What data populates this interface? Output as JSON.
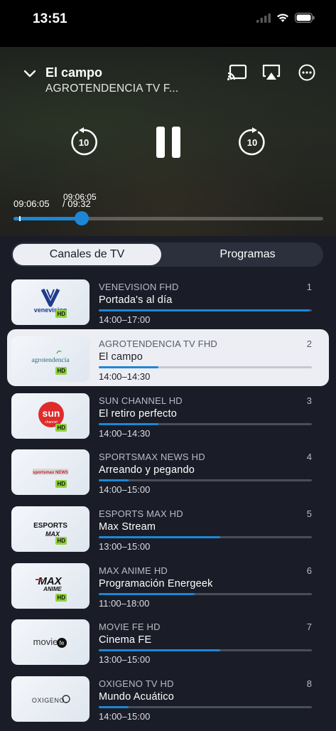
{
  "status": {
    "time": "13:51"
  },
  "player": {
    "title": "El campo",
    "subtitle": "AGROTENDENCIA TV F...",
    "skip_back_label": "10",
    "skip_fwd_label": "10",
    "time_current": "09:06:05",
    "time_hover": "09:06:05",
    "time_total": "/ 09:32",
    "progress_fraction": 0.22
  },
  "tabs": {
    "channels": "Canales de TV",
    "programs": "Programas"
  },
  "channels": [
    {
      "name": "VENEVISION FHD",
      "number": "1",
      "program": "Portada's al día",
      "times": "14:00–17:00",
      "progress": 0.99,
      "logo": "venevision",
      "hd": "HD"
    },
    {
      "name": "AGROTENDENCIA TV FHD",
      "number": "2",
      "program": "El campo",
      "times": "14:00–14:30",
      "progress": 0.28,
      "logo": "agrotendencia",
      "hd": "HD"
    },
    {
      "name": "SUN CHANNEL HD",
      "number": "3",
      "program": "El retiro perfecto",
      "times": "14:00–14:30",
      "progress": 0.28,
      "logo": "sun",
      "hd": "HD"
    },
    {
      "name": "SPORTSMAX NEWS HD",
      "number": "4",
      "program": "Arreando y pegando",
      "times": "14:00–15:00",
      "progress": 0.14,
      "logo": "sportsmax",
      "hd": "HD"
    },
    {
      "name": "ESPORTS MAX HD",
      "number": "5",
      "program": "Max Stream",
      "times": "13:00–15:00",
      "progress": 0.57,
      "logo": "esports",
      "hd": "HD"
    },
    {
      "name": "MAX ANIME HD",
      "number": "6",
      "program": "Programación Energeek",
      "times": "11:00–18:00",
      "progress": 0.45,
      "logo": "maxanime",
      "hd": "HD"
    },
    {
      "name": "MOVIE FE HD",
      "number": "7",
      "program": "Cinema FE",
      "times": "13:00–15:00",
      "progress": 0.57,
      "logo": "moviefe",
      "hd": ""
    },
    {
      "name": "OXIGENO TV HD",
      "number": "8",
      "program": "Mundo Acuático",
      "times": "14:00–15:00",
      "progress": 0.14,
      "logo": "oxigeno",
      "hd": ""
    }
  ],
  "logos": {
    "venevision": "venevision",
    "agrotendencia": "agrotendencia",
    "sun": "sun",
    "sun_sub": "channel",
    "sportsmax": "sportsmax NEWS",
    "esports": "ESPORTS",
    "esports_sub": "MAX",
    "maxanime": "MAX",
    "maxanime_sub": "ANIME",
    "moviefe": "movie",
    "moviefe_sub": "fe",
    "oxigeno": "OXIGENO"
  },
  "colors": {
    "accent": "#1d87d6",
    "background": "#1a1d27",
    "selected_row": "#eceef3"
  }
}
